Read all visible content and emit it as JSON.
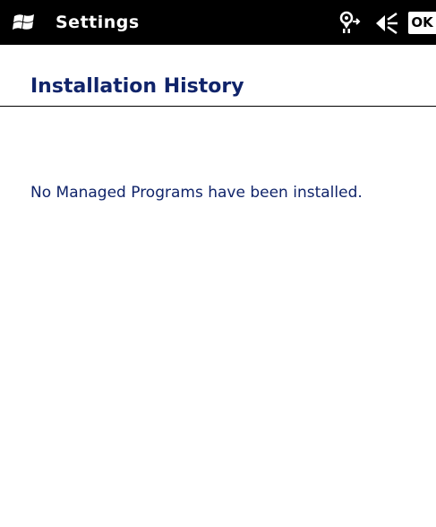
{
  "title_bar": {
    "app_title": "Settings",
    "start_icon": "windows-flag-icon",
    "status_icons": [
      "connectivity-icon",
      "volume-icon"
    ],
    "ok_label": "OK"
  },
  "page": {
    "title": "Installation History"
  },
  "content": {
    "message": "No Managed Programs have been installed."
  },
  "colors": {
    "titlebar_background": "#000000",
    "titlebar_text": "#ffffff",
    "heading_text": "#10246a",
    "body_text": "#10246a",
    "background": "#ffffff"
  }
}
